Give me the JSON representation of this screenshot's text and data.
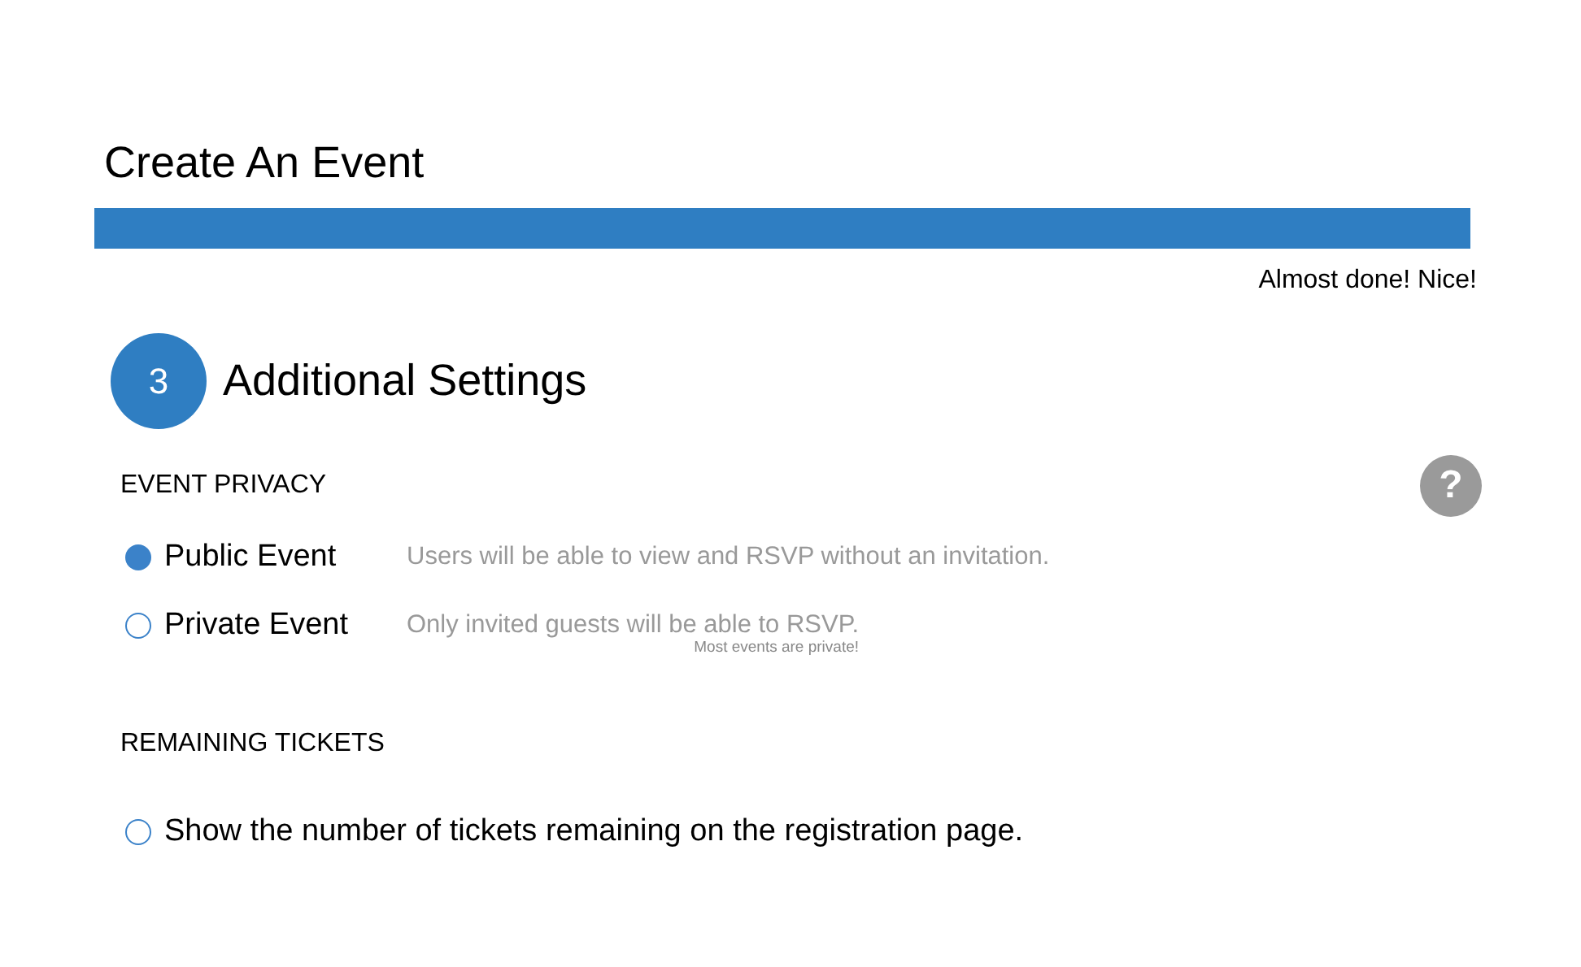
{
  "page_title": "Create An Event",
  "progress": {
    "message": "Almost done! Nice!"
  },
  "step": {
    "number": "3",
    "title": "Additional Settings"
  },
  "help_button": {
    "label": "?"
  },
  "event_privacy": {
    "heading": "EVENT PRIVACY",
    "options": [
      {
        "label": "Public Event",
        "description": "Users will be able to view and RSVP without an invitation.",
        "selected": true
      },
      {
        "label": "Private Event",
        "description": "Only invited guests will be able to RSVP.",
        "note": "Most events are private!",
        "selected": false
      }
    ]
  },
  "remaining_tickets": {
    "heading": "REMAINING TICKETS",
    "option": {
      "label": "Show the number of tickets remaining on the registration page.",
      "checked": false
    }
  }
}
